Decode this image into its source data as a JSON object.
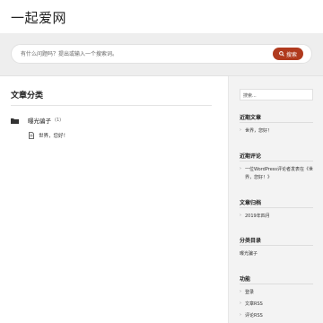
{
  "site": {
    "title": "一起爱网"
  },
  "search": {
    "placeholder": "有什么问题吗？提出或输入一个搜索词。",
    "button_label": "搜索"
  },
  "main": {
    "section_title": "文章分类",
    "category": {
      "name": "曝光骗子",
      "count": "(1)"
    },
    "post": {
      "title": "世界，您好！"
    }
  },
  "sidebar": {
    "search_placeholder": "搜索...",
    "recent_posts": {
      "title": "近期文章",
      "items": [
        "世界，您好！"
      ]
    },
    "recent_comments": {
      "title": "近期评论",
      "items": [
        "一位WordPress评论者发表在《世界，您好！》"
      ]
    },
    "archives": {
      "title": "文章归档",
      "items": [
        "2019年四月"
      ]
    },
    "categories": {
      "title": "分类目录",
      "items": [
        "曝光骗子"
      ]
    },
    "meta": {
      "title": "功能",
      "items": [
        "登录",
        "文章RSS",
        "评论RSS"
      ]
    }
  },
  "colors": {
    "accent": "#b03a1e",
    "band": "#eeeeee",
    "sidebar_bg": "#f3f3f3"
  }
}
